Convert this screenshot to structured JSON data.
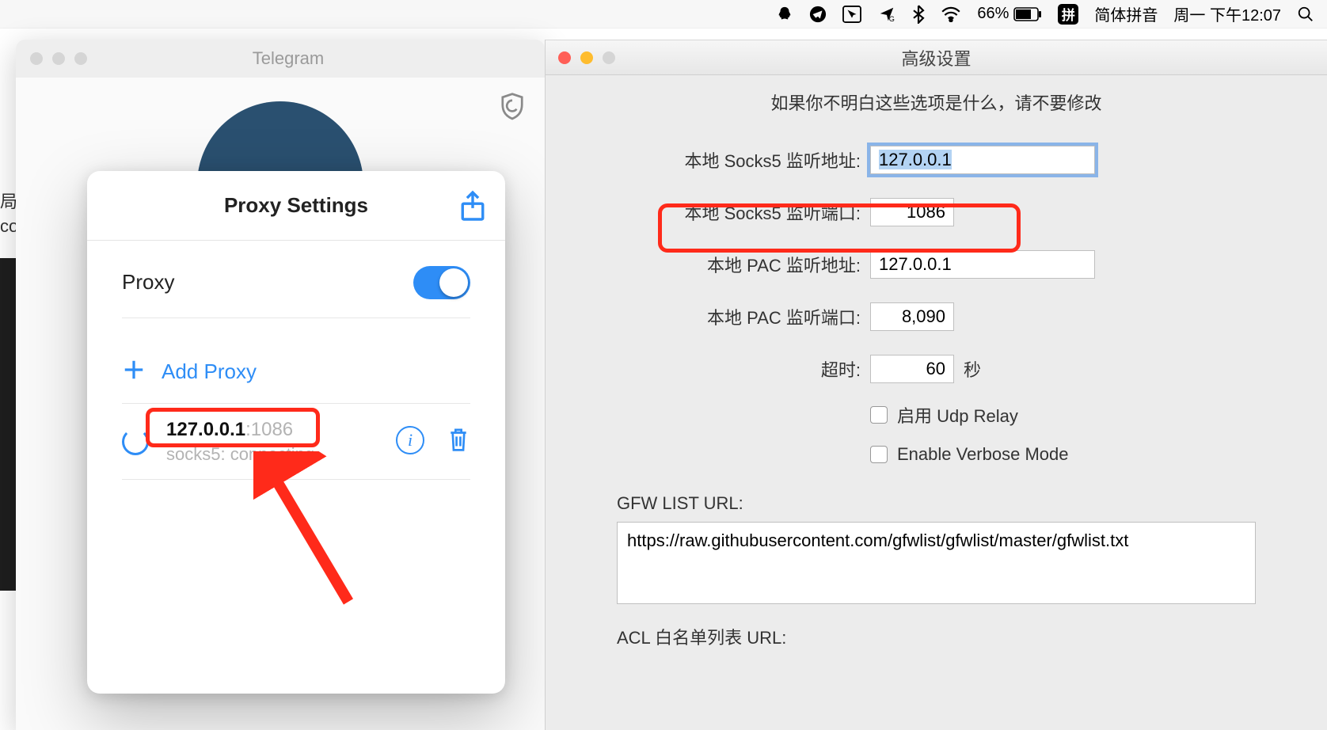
{
  "menubar": {
    "battery_pct": "66%",
    "ime_badge": "拼",
    "ime_name": "简体拼音",
    "clock": "周一 下午12:07"
  },
  "left_peek": {
    "line1": "局",
    "line2": "co"
  },
  "telegram": {
    "title": "Telegram"
  },
  "proxy_modal": {
    "title": "Proxy Settings",
    "proxy_label": "Proxy",
    "add_proxy": "Add Proxy",
    "item": {
      "ip": "127.0.0.1",
      "port": ":1086",
      "status": "socks5: connecting"
    }
  },
  "ss": {
    "title": "高级设置",
    "warning": "如果你不明白这些选项是什么，请不要修改",
    "rows": {
      "socks_addr_label": "本地 Socks5 监听地址:",
      "socks_addr_value": "127.0.0.1",
      "socks_port_label": "本地 Socks5 监听端口:",
      "socks_port_value": "1086",
      "pac_addr_label": "本地 PAC 监听地址:",
      "pac_addr_value": "127.0.0.1",
      "pac_port_label": "本地 PAC 监听端口:",
      "pac_port_value": "8,090",
      "timeout_label": "超时:",
      "timeout_value": "60",
      "timeout_unit": "秒",
      "udp_relay": "启用 Udp Relay",
      "verbose": "Enable Verbose Mode"
    },
    "gfw_label": "GFW LIST URL:",
    "gfw_url": "https://raw.githubusercontent.com/gfwlist/gfwlist/master/gfwlist.txt",
    "acl_label": "ACL 白名单列表 URL:"
  }
}
